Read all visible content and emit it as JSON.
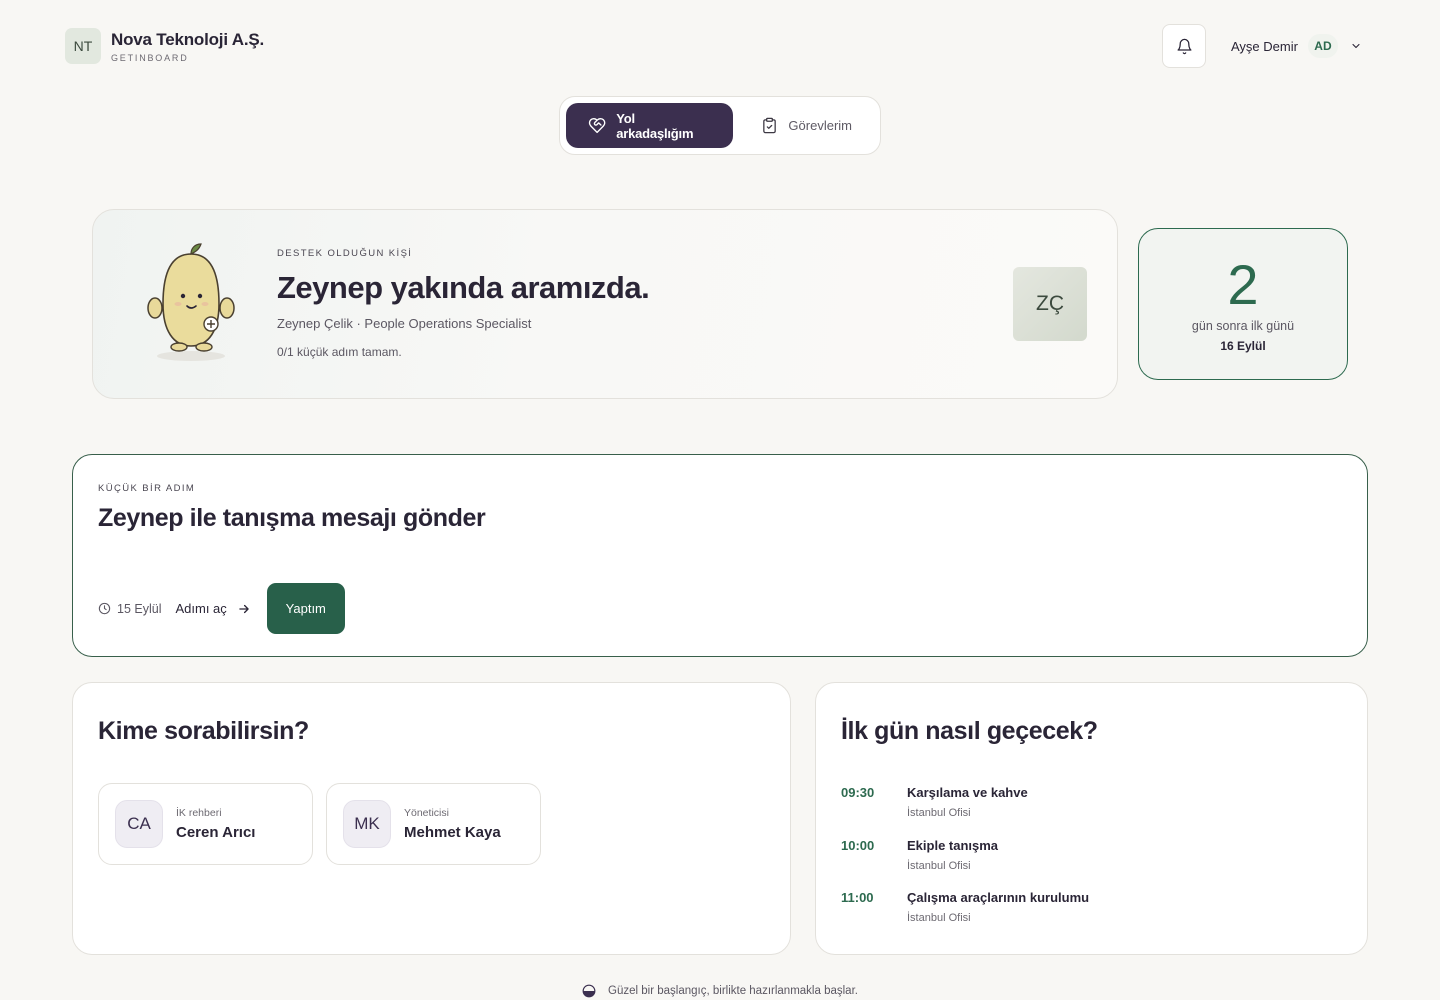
{
  "brand": {
    "logo": "NT",
    "name": "Nova Teknoloji A.Ş.",
    "product": "GETINBOARD"
  },
  "header": {
    "user_name": "Ayşe Demir",
    "user_initials": "AD"
  },
  "tabs": [
    {
      "label": "Yol arkadaşlığım",
      "active": true,
      "icon": "heart-handshake-icon"
    },
    {
      "label": "Görevlerim",
      "active": false,
      "icon": "clipboard-check-icon"
    }
  ],
  "hero": {
    "kicker": "DESTEK OLDUĞUN KİŞİ",
    "title": "Zeynep yakında aramızda.",
    "subtitle": "Zeynep Çelik · People Operations Specialist",
    "progress": "0/1 küçük adım tamam.",
    "avatar_initials": "ZÇ"
  },
  "countdown": {
    "days": "2",
    "label": "gün sonra ilk günü",
    "date": "16 Eylül"
  },
  "step": {
    "kicker": "KÜÇÜK BİR ADIM",
    "title": "Zeynep ile tanışma mesajı gönder",
    "due": "15 Eylül",
    "open_label": "Adımı aç",
    "done_label": "Yaptım"
  },
  "contacts": {
    "title": "Kime sorabilirsin?",
    "items": [
      {
        "initials": "CA",
        "role": "İK rehberi",
        "name": "Ceren Arıcı"
      },
      {
        "initials": "MK",
        "role": "Yöneticisi",
        "name": "Mehmet Kaya"
      }
    ]
  },
  "schedule": {
    "title": "İlk gün nasıl geçecek?",
    "items": [
      {
        "time": "09:30",
        "title": "Karşılama ve kahve",
        "place": "İstanbul Ofisi"
      },
      {
        "time": "10:00",
        "title": "Ekiple tanışma",
        "place": "İstanbul Ofisi"
      },
      {
        "time": "11:00",
        "title": "Çalışma araçlarının kurulumu",
        "place": "İstanbul Ofisi"
      }
    ]
  },
  "footer": {
    "text": "Güzel bir başlangıç, birlikte hazırlanmakla başlar."
  },
  "colors": {
    "primary": "#3b2f4f",
    "accent": "#2d6a4f",
    "background": "#f8f7f4"
  }
}
